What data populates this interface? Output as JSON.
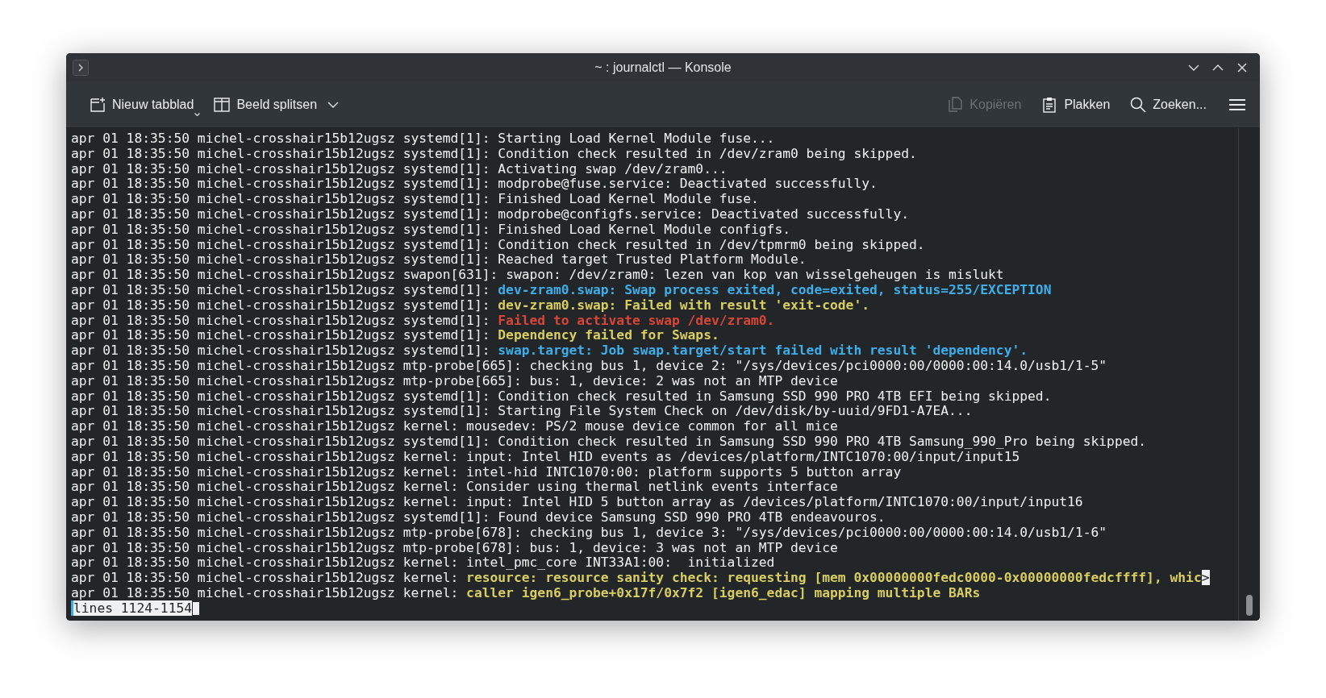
{
  "window": {
    "title": "~ : journalctl — Konsole"
  },
  "toolbar": {
    "buttons": [
      {
        "kind": "new_tab",
        "label": "Nieuw tabblad",
        "disabled": false
      },
      {
        "kind": "split",
        "label": "Beeld splitsen",
        "disabled": false
      },
      {
        "kind": "copy",
        "label": "Kopiëren",
        "disabled": true
      },
      {
        "kind": "paste",
        "label": "Plakken",
        "disabled": false
      },
      {
        "kind": "search",
        "label": "Zoeken...",
        "disabled": false
      }
    ]
  },
  "terminal": {
    "lines": [
      {
        "prefix": "apr 01 18:35:50 michel-crosshair15b12ugsz systemd[1]:",
        "message": "Starting Load Kernel Module fuse...",
        "kind": "normal"
      },
      {
        "prefix": "apr 01 18:35:50 michel-crosshair15b12ugsz systemd[1]:",
        "message": "Condition check resulted in /dev/zram0 being skipped.",
        "kind": "normal"
      },
      {
        "prefix": "apr 01 18:35:50 michel-crosshair15b12ugsz systemd[1]:",
        "message": "Activating swap /dev/zram0...",
        "kind": "normal"
      },
      {
        "prefix": "apr 01 18:35:50 michel-crosshair15b12ugsz systemd[1]:",
        "message": "modprobe@fuse.service: Deactivated successfully.",
        "kind": "normal"
      },
      {
        "prefix": "apr 01 18:35:50 michel-crosshair15b12ugsz systemd[1]:",
        "message": "Finished Load Kernel Module fuse.",
        "kind": "normal"
      },
      {
        "prefix": "apr 01 18:35:50 michel-crosshair15b12ugsz systemd[1]:",
        "message": "modprobe@configfs.service: Deactivated successfully.",
        "kind": "normal"
      },
      {
        "prefix": "apr 01 18:35:50 michel-crosshair15b12ugsz systemd[1]:",
        "message": "Finished Load Kernel Module configfs.",
        "kind": "normal"
      },
      {
        "prefix": "apr 01 18:35:50 michel-crosshair15b12ugsz systemd[1]:",
        "message": "Condition check resulted in /dev/tpmrm0 being skipped.",
        "kind": "normal"
      },
      {
        "prefix": "apr 01 18:35:50 michel-crosshair15b12ugsz systemd[1]:",
        "message": "Reached target Trusted Platform Module.",
        "kind": "normal"
      },
      {
        "prefix": "apr 01 18:35:50 michel-crosshair15b12ugsz swapon[631]:",
        "message": "swapon: /dev/zram0: lezen van kop van wisselgeheugen is mislukt",
        "kind": "normal"
      },
      {
        "prefix": "apr 01 18:35:50 michel-crosshair15b12ugsz systemd[1]:",
        "message": "dev-zram0.swap: Swap process exited, code=exited, status=255/EXCEPTION",
        "kind": "info"
      },
      {
        "prefix": "apr 01 18:35:50 michel-crosshair15b12ugsz systemd[1]:",
        "message": "dev-zram0.swap: Failed with result 'exit-code'.",
        "kind": "warning"
      },
      {
        "prefix": "apr 01 18:35:50 michel-crosshair15b12ugsz systemd[1]:",
        "message": "Failed to activate swap /dev/zram0.",
        "kind": "error"
      },
      {
        "prefix": "apr 01 18:35:50 michel-crosshair15b12ugsz systemd[1]:",
        "message": "Dependency failed for Swaps.",
        "kind": "warning"
      },
      {
        "prefix": "apr 01 18:35:50 michel-crosshair15b12ugsz systemd[1]:",
        "message": "swap.target: Job swap.target/start failed with result 'dependency'.",
        "kind": "info"
      },
      {
        "prefix": "apr 01 18:35:50 michel-crosshair15b12ugsz mtp-probe[665]:",
        "message": "checking bus 1, device 2: \"/sys/devices/pci0000:00/0000:00:14.0/usb1/1-5\"",
        "kind": "normal"
      },
      {
        "prefix": "apr 01 18:35:50 michel-crosshair15b12ugsz mtp-probe[665]:",
        "message": "bus: 1, device: 2 was not an MTP device",
        "kind": "normal"
      },
      {
        "prefix": "apr 01 18:35:50 michel-crosshair15b12ugsz systemd[1]:",
        "message": "Condition check resulted in Samsung SSD 990 PRO 4TB EFI being skipped.",
        "kind": "normal"
      },
      {
        "prefix": "apr 01 18:35:50 michel-crosshair15b12ugsz systemd[1]:",
        "message": "Starting File System Check on /dev/disk/by-uuid/9FD1-A7EA...",
        "kind": "normal"
      },
      {
        "prefix": "apr 01 18:35:50 michel-crosshair15b12ugsz kernel:",
        "message": "mousedev: PS/2 mouse device common for all mice",
        "kind": "normal"
      },
      {
        "prefix": "apr 01 18:35:50 michel-crosshair15b12ugsz systemd[1]:",
        "message": "Condition check resulted in Samsung SSD 990 PRO 4TB Samsung_990_Pro being skipped.",
        "kind": "normal"
      },
      {
        "prefix": "apr 01 18:35:50 michel-crosshair15b12ugsz kernel:",
        "message": "input: Intel HID events as /devices/platform/INTC1070:00/input/input15",
        "kind": "normal"
      },
      {
        "prefix": "apr 01 18:35:50 michel-crosshair15b12ugsz kernel:",
        "message": "intel-hid INTC1070:00: platform supports 5 button array",
        "kind": "normal"
      },
      {
        "prefix": "apr 01 18:35:50 michel-crosshair15b12ugsz kernel:",
        "message": "Consider using thermal netlink events interface",
        "kind": "normal"
      },
      {
        "prefix": "apr 01 18:35:50 michel-crosshair15b12ugsz kernel:",
        "message": "input: Intel HID 5 button array as /devices/platform/INTC1070:00/input/input16",
        "kind": "normal"
      },
      {
        "prefix": "apr 01 18:35:50 michel-crosshair15b12ugsz systemd[1]:",
        "message": "Found device Samsung SSD 990 PRO 4TB endeavouros.",
        "kind": "normal"
      },
      {
        "prefix": "apr 01 18:35:50 michel-crosshair15b12ugsz mtp-probe[678]:",
        "message": "checking bus 1, device 3: \"/sys/devices/pci0000:00/0000:00:14.0/usb1/1-6\"",
        "kind": "normal"
      },
      {
        "prefix": "apr 01 18:35:50 michel-crosshair15b12ugsz mtp-probe[678]:",
        "message": "bus: 1, device: 3 was not an MTP device",
        "kind": "normal"
      },
      {
        "prefix": "apr 01 18:35:50 michel-crosshair15b12ugsz kernel:",
        "message": "intel_pmc_core INT33A1:00:  initialized",
        "kind": "normal"
      },
      {
        "prefix": "apr 01 18:35:50 michel-crosshair15b12ugsz kernel:",
        "message": "resource: resource sanity check: requesting [mem 0x00000000fedc0000-0x00000000fedcffff], whic",
        "kind": "warning",
        "overflow_marker": ">"
      },
      {
        "prefix": "apr 01 18:35:50 michel-crosshair15b12ugsz kernel:",
        "message": "caller igen6_probe+0x17f/0x7f2 [igen6_edac] mapping multiple BARs",
        "kind": "warning"
      }
    ],
    "status_line": "lines 1124-1154"
  }
}
